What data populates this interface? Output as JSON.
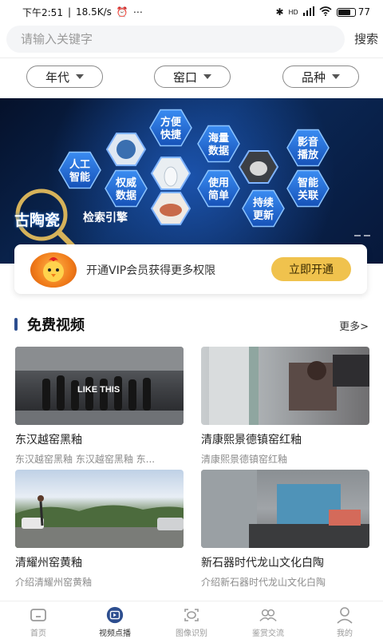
{
  "status_bar": {
    "time": "下午2:51",
    "speed": "18.5K/s",
    "network": "HD",
    "battery": "77",
    "battery_level": 0.77
  },
  "search": {
    "placeholder": "请输入关键字",
    "button_label": "搜索"
  },
  "filters": [
    {
      "label": "年代"
    },
    {
      "label": "窑口"
    },
    {
      "label": "品种"
    }
  ],
  "banner": {
    "hexagons": [
      {
        "line1": "方便",
        "line2": "快捷"
      },
      {
        "line1": "海量",
        "line2": "数据"
      },
      {
        "line1": "影音",
        "line2": "播放"
      },
      {
        "line1": "人工",
        "line2": "智能"
      },
      {
        "line1": "权威",
        "line2": "数据"
      },
      {
        "line1": "使用",
        "line2": "简单"
      },
      {
        "line1": "智能",
        "line2": "关联"
      },
      {
        "line1": "持续",
        "line2": "更新"
      }
    ],
    "title": "古陶瓷",
    "subtitle": "检索引擎"
  },
  "vip": {
    "text": "开通VIP会员获得更多权限",
    "button_label": "立即开通"
  },
  "section": {
    "title": "免费视频",
    "more_label": "更多>"
  },
  "videos": [
    {
      "title": "东汉越窑黑釉",
      "desc": "东汉越窑黑釉 东汉越窑黑釉 东...",
      "overlay": "LIKE THIS"
    },
    {
      "title": "清康熙景德镇窑红釉",
      "desc": "清康熙景德镇窑红釉",
      "overlay": ""
    },
    {
      "title": "清耀州窑黄釉",
      "desc": "介绍清耀州窑黄釉",
      "overlay": ""
    },
    {
      "title": "新石器时代龙山文化白陶",
      "desc": "介绍新石器时代龙山文化白陶",
      "overlay": ""
    }
  ],
  "bottom_nav": [
    {
      "label": "首页",
      "icon": "home-icon",
      "active": false
    },
    {
      "label": "视频点播",
      "icon": "video-icon",
      "active": true
    },
    {
      "label": "图像识别",
      "icon": "image-recognition-icon",
      "active": false
    },
    {
      "label": "鉴赏交流",
      "icon": "community-icon",
      "active": false
    },
    {
      "label": "我的",
      "icon": "profile-icon",
      "active": false
    }
  ],
  "colors": {
    "accent": "#2d4e8f",
    "vip_button": "#f0c24d",
    "banner_bg": "#0b2a5a",
    "hex_fill": "#1f6fd1"
  }
}
